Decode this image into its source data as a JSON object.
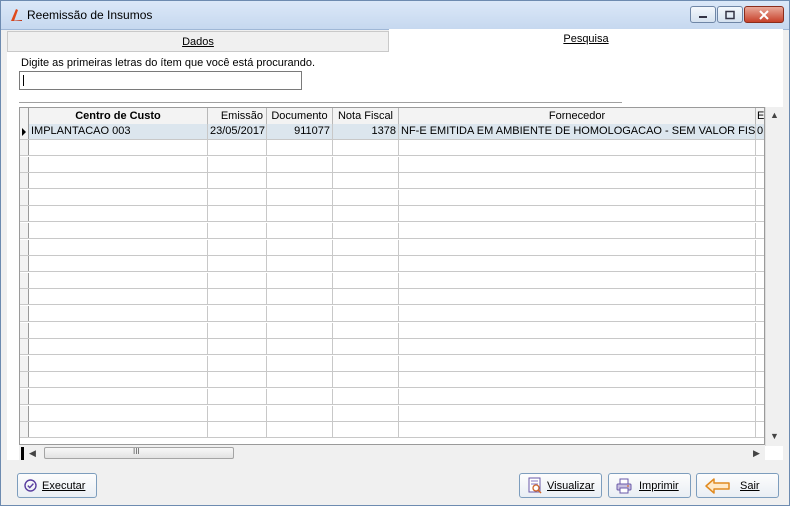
{
  "window": {
    "title": "Reemissão de Insumos"
  },
  "tabs": [
    {
      "label": "Dados"
    },
    {
      "label": "Pesquisa"
    }
  ],
  "search": {
    "label": "Digite as primeiras letras do ítem que você está procurando.",
    "value": ""
  },
  "grid": {
    "columns": [
      "Centro de Custo",
      "Emissão",
      "Documento",
      "Nota Fiscal",
      "Fornecedor",
      "Er"
    ],
    "rows": [
      {
        "centro_de_custo": "IMPLANTACAO 003",
        "emissao": "23/05/2017",
        "documento": "911077",
        "nota_fiscal": "1378",
        "fornecedor": "NF-E EMITIDA EM AMBIENTE DE HOMOLOGACAO - SEM VALOR FISCAL",
        "er": "0"
      }
    ],
    "scroll_thumb_glyph": "III"
  },
  "buttons": {
    "executar": "Executar",
    "visualizar": "Visualizar",
    "imprimir": "Imprimir",
    "sair": "Sair"
  }
}
